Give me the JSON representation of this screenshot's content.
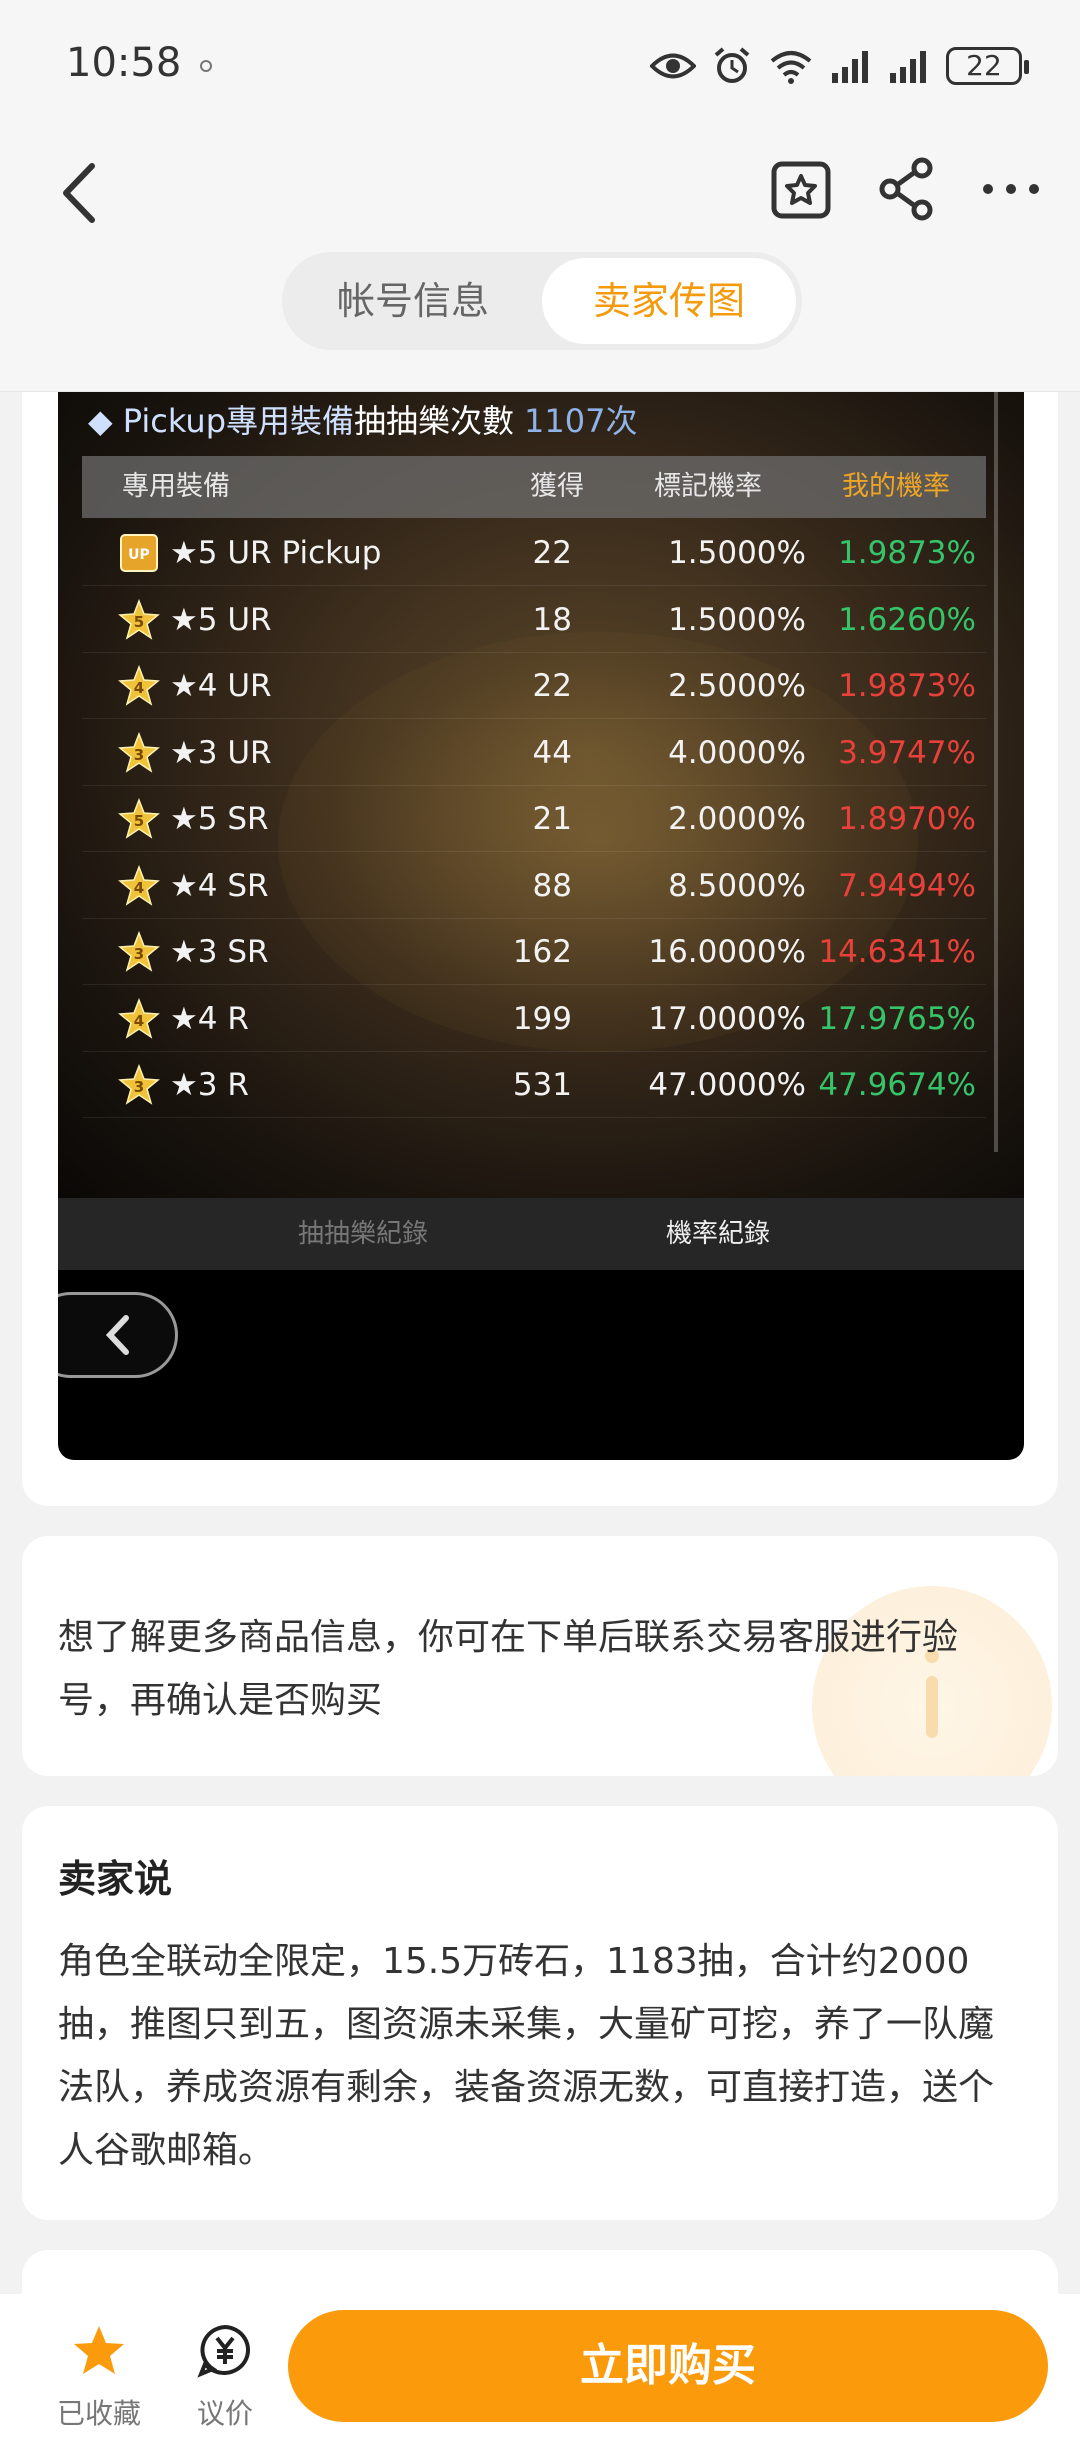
{
  "status_bar": {
    "time": "10:58",
    "battery": "22"
  },
  "header": {
    "tabs": [
      {
        "label": "帐号信息",
        "active": false
      },
      {
        "label": "卖家传图",
        "active": true
      }
    ]
  },
  "screenshot": {
    "title_prefix": "◆ Pickup專用裝備",
    "title_main": "抽抽樂次數",
    "title_count": "1107次",
    "columns": [
      "專用裝備",
      "獲得",
      "標記機率",
      "我的機率"
    ],
    "rows": [
      {
        "badge": "UP",
        "name": "★5 UR Pickup",
        "got": "22",
        "rate": "1.5000%",
        "mine": "1.9873%",
        "color": "#36c46a"
      },
      {
        "badge": "5",
        "name": "★5 UR",
        "got": "18",
        "rate": "1.5000%",
        "mine": "1.6260%",
        "color": "#36c46a"
      },
      {
        "badge": "4",
        "name": "★4 UR",
        "got": "22",
        "rate": "2.5000%",
        "mine": "1.9873%",
        "color": "#e8413b"
      },
      {
        "badge": "3",
        "name": "★3 UR",
        "got": "44",
        "rate": "4.0000%",
        "mine": "3.9747%",
        "color": "#e8413b"
      },
      {
        "badge": "5",
        "name": "★5 SR",
        "got": "21",
        "rate": "2.0000%",
        "mine": "1.8970%",
        "color": "#e8413b"
      },
      {
        "badge": "4",
        "name": "★4 SR",
        "got": "88",
        "rate": "8.5000%",
        "mine": "7.9494%",
        "color": "#e8413b"
      },
      {
        "badge": "3",
        "name": "★3 SR",
        "got": "162",
        "rate": "16.0000%",
        "mine": "14.6341%",
        "color": "#e8413b"
      },
      {
        "badge": "4",
        "name": "★4 R",
        "got": "199",
        "rate": "17.0000%",
        "mine": "17.9765%",
        "color": "#36c46a"
      },
      {
        "badge": "3",
        "name": "★3 R",
        "got": "531",
        "rate": "47.0000%",
        "mine": "47.9674%",
        "color": "#36c46a"
      }
    ],
    "tabs": [
      "抽抽樂紀錄",
      "機率紀錄"
    ]
  },
  "notice": {
    "text": "想了解更多商品信息，你可在下单后联系交易客服进行验号，再确认是否购买"
  },
  "seller": {
    "heading": "卖家说",
    "text": "角色全联动全限定，15.5万砖石，1183抽，合计约2000抽，推图只到五，图资源未采集，大量矿可挖，养了一队魔法队，养成资源有剩余，装备资源无数，可直接打造，送个人谷歌邮箱。"
  },
  "bottom_bar": {
    "favorite_label": "已收藏",
    "bargain_label": "议价",
    "buy_label": "立即购买"
  },
  "colors": {
    "accent": "#fb9b0c",
    "tab_active": "#f59a0c"
  }
}
